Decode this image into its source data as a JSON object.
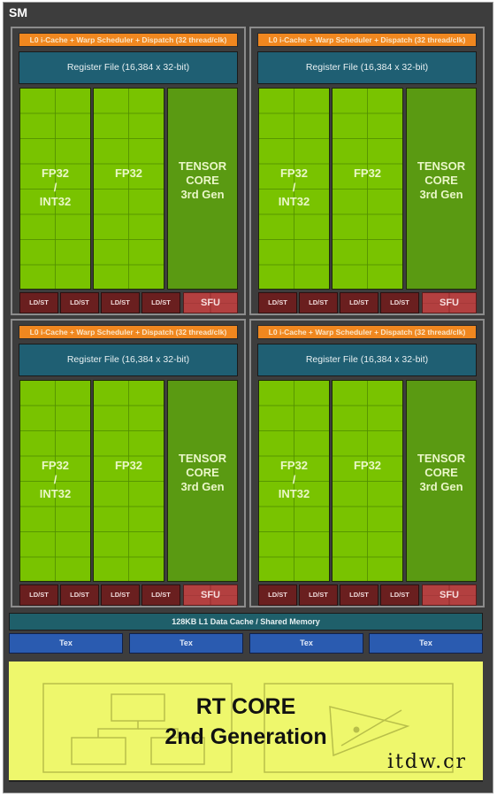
{
  "sm": {
    "title": "SM",
    "quadrants": [
      {
        "l0_label": "L0 i-Cache + Warp Scheduler + Dispatch (32 thread/clk)",
        "register_file_label": "Register File (16,384 x 32-bit)",
        "fp32_int32": {
          "line1": "FP32",
          "line2": "/",
          "line3": "INT32"
        },
        "fp32": {
          "label": "FP32"
        },
        "tensor": {
          "line1": "TENSOR",
          "line2": "CORE",
          "line3": "3rd Gen"
        },
        "ldst_labels": [
          "LD/ST",
          "LD/ST",
          "LD/ST",
          "LD/ST"
        ],
        "sfu_label": "SFU"
      },
      {
        "l0_label": "L0 i-Cache + Warp Scheduler + Dispatch (32 thread/clk)",
        "register_file_label": "Register File (16,384 x 32-bit)",
        "fp32_int32": {
          "line1": "FP32",
          "line2": "/",
          "line3": "INT32"
        },
        "fp32": {
          "label": "FP32"
        },
        "tensor": {
          "line1": "TENSOR",
          "line2": "CORE",
          "line3": "3rd Gen"
        },
        "ldst_labels": [
          "LD/ST",
          "LD/ST",
          "LD/ST",
          "LD/ST"
        ],
        "sfu_label": "SFU"
      },
      {
        "l0_label": "L0 i-Cache + Warp Scheduler + Dispatch (32 thread/clk)",
        "register_file_label": "Register File (16,384 x 32-bit)",
        "fp32_int32": {
          "line1": "FP32",
          "line2": "/",
          "line3": "INT32"
        },
        "fp32": {
          "label": "FP32"
        },
        "tensor": {
          "line1": "TENSOR",
          "line2": "CORE",
          "line3": "3rd Gen"
        },
        "ldst_labels": [
          "LD/ST",
          "LD/ST",
          "LD/ST",
          "LD/ST"
        ],
        "sfu_label": "SFU"
      },
      {
        "l0_label": "L0 i-Cache + Warp Scheduler + Dispatch (32 thread/clk)",
        "register_file_label": "Register File (16,384 x 32-bit)",
        "fp32_int32": {
          "line1": "FP32",
          "line2": "/",
          "line3": "INT32"
        },
        "fp32": {
          "label": "FP32"
        },
        "tensor": {
          "line1": "TENSOR",
          "line2": "CORE",
          "line3": "3rd Gen"
        },
        "ldst_labels": [
          "LD/ST",
          "LD/ST",
          "LD/ST",
          "LD/ST"
        ],
        "sfu_label": "SFU"
      }
    ],
    "l1_label": "128KB L1 Data Cache / Shared Memory",
    "tex_labels": [
      "Tex",
      "Tex",
      "Tex",
      "Tex"
    ],
    "rt_core": {
      "line1": "RT CORE",
      "line2": "2nd Generation"
    },
    "watermark": "itdw.cr"
  },
  "colors": {
    "background": "#3d3d3d",
    "l0": "#f0871f",
    "register_file": "#1f5f73",
    "fp32": "#79c300",
    "tensor": "#5a9a12",
    "ldst": "#6a1f1f",
    "sfu": "#b34040",
    "l1": "#1f5f6a",
    "tex": "#2a5bb0",
    "rt_core": "#eef76c"
  }
}
